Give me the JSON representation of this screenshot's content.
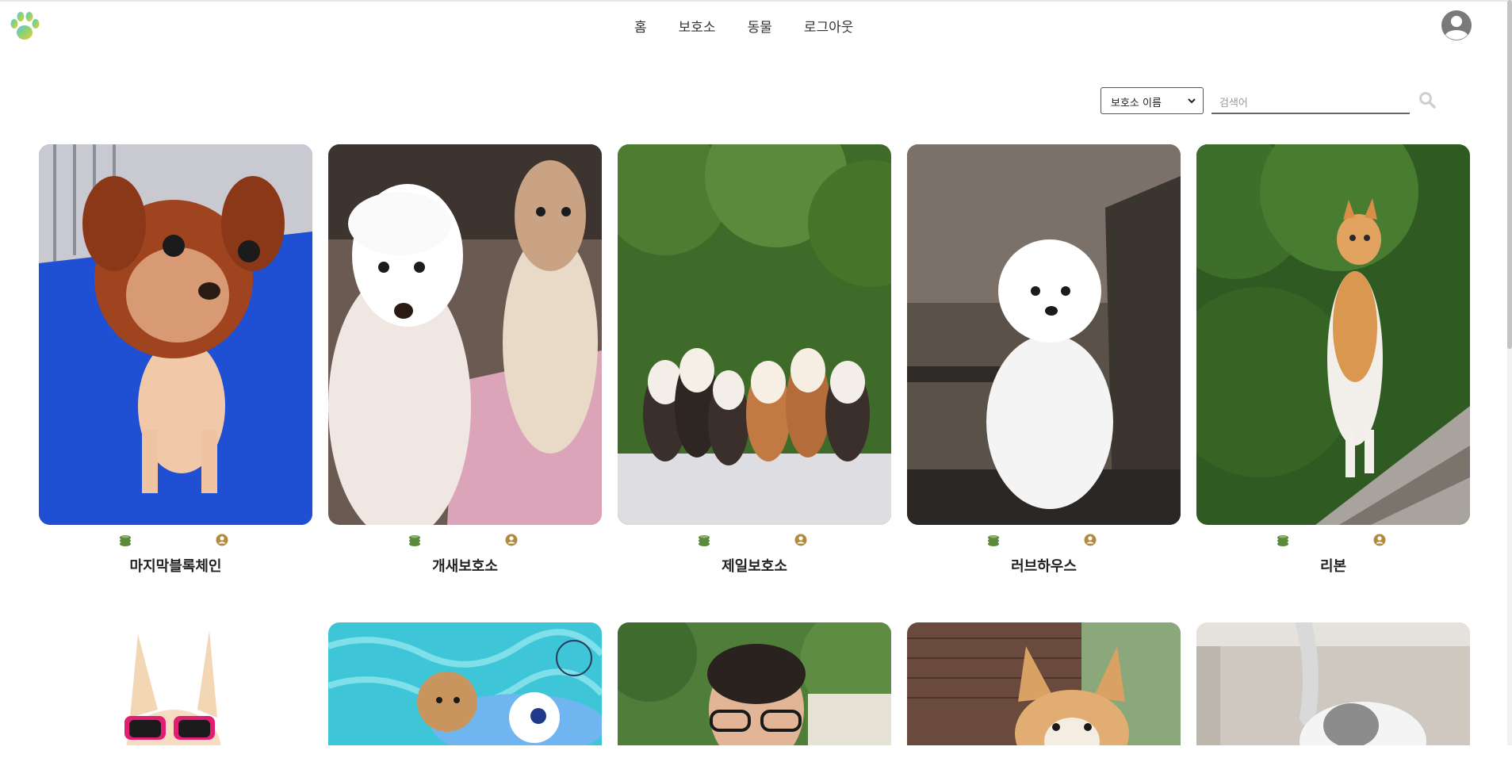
{
  "nav": {
    "items": [
      "홈",
      "보호소",
      "동물",
      "로그아웃"
    ]
  },
  "icons": {
    "logo": "paw-logo",
    "avatar": "user-avatar-icon",
    "search": "search-icon",
    "donate": "coins-icon",
    "profile": "user-circle-icon"
  },
  "search": {
    "filter_selected": "보호소 이름",
    "placeholder": "검색어"
  },
  "colors": {
    "coin_green": "#5a8a3a",
    "person_gold": "#b08a3e",
    "nav_text": "#333333"
  },
  "shelters": [
    {
      "name": "마지막블록체인",
      "photo": "red-fluffy-dog-on-blue-mat"
    },
    {
      "name": "개새보호소",
      "photo": "two-shaggy-white-dogs"
    },
    {
      "name": "제일보호소",
      "photo": "row-of-corgi-puppies"
    },
    {
      "name": "러브하우스",
      "photo": "white-bichon-on-chair"
    },
    {
      "name": "리본",
      "photo": "orange-white-cat-in-garden"
    }
  ],
  "shelters_row2": [
    {
      "photo": "dog-with-pink-sunglasses"
    },
    {
      "photo": "poodle-in-pool-float"
    },
    {
      "photo": "man-with-glasses-portrait"
    },
    {
      "photo": "corgi-by-brick-wall"
    },
    {
      "photo": "white-cat-tail-up"
    }
  ]
}
